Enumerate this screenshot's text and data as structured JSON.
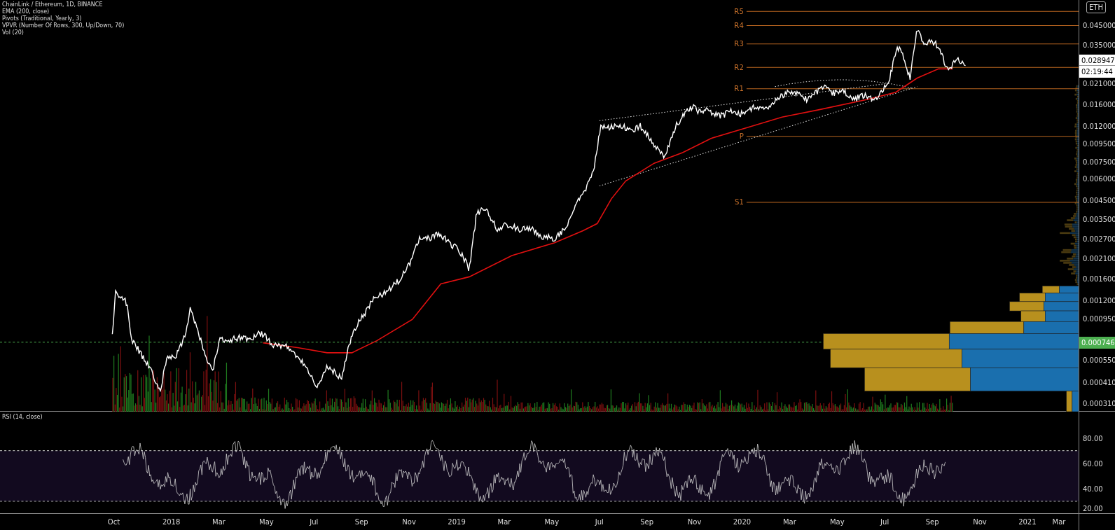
{
  "legend": [
    "ChainLink / Ethereum, 1D, BINANCE",
    "EMA (200, close)",
    "Pivots (Traditional, Yearly, 3)",
    "VPVR (Number Of Rows, 300, Up/Down, 70)",
    "Vol (20)"
  ],
  "pivots": [
    {
      "label": "R5"
    },
    {
      "label": "R4"
    },
    {
      "label": "R3"
    },
    {
      "label": "R2"
    },
    {
      "label": "R1"
    },
    {
      "label": "P"
    },
    {
      "label": "S1"
    }
  ],
  "price_axis": {
    "currency": "ETH",
    "ticks": [
      "0.045000",
      "0.035000",
      "0.021000",
      "0.016000",
      "0.012000",
      "0.009500",
      "0.007500",
      "0.006000",
      "0.004500",
      "0.003500",
      "0.002700",
      "0.002100",
      "0.001600",
      "0.001200",
      "0.000950",
      "0.000550",
      "0.000410",
      "0.000310"
    ],
    "last_price": "0.028947",
    "countdown": "02:19:44",
    "marker_price": "0.000746"
  },
  "rsi": {
    "title": "RSI (14, close)",
    "ticks": [
      "80.00",
      "60.00",
      "40.00",
      "20.00"
    ]
  },
  "time_axis": [
    "Oct",
    "2018",
    "Mar",
    "May",
    "Jul",
    "Sep",
    "Nov",
    "2019",
    "Mar",
    "May",
    "Jul",
    "Sep",
    "Nov",
    "2020",
    "Mar",
    "May",
    "Jul",
    "Sep",
    "Nov",
    "2021",
    "Mar"
  ]
}
